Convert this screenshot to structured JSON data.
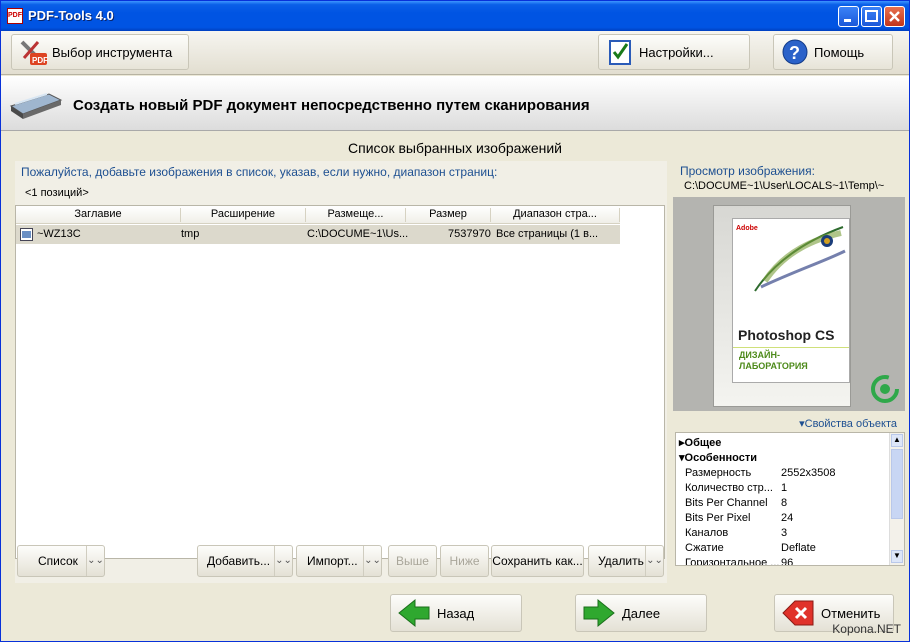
{
  "window": {
    "title": "PDF-Tools 4.0",
    "icon_text": "PDF"
  },
  "toolbar": {
    "select_tool": "Выбор инструмента",
    "settings": "Настройки...",
    "help": "Помощь"
  },
  "banner": {
    "title": "Создать новый PDF документ непосредственно путем сканирования"
  },
  "panel": {
    "header": "Список выбранных изображений",
    "hint": "Пожалуйста, добавьте изображения в список, указав, если нужно, диапазон страниц:",
    "count": "<1 позиций>"
  },
  "grid": {
    "columns": [
      "Заглавие",
      "Расширение",
      "Размеще...",
      "Размер",
      "Диапазон стра..."
    ],
    "rows": [
      {
        "name": "~WZ13C",
        "ext": "tmp",
        "location": "C:\\DOCUME~1\\Us...",
        "size": "7537970",
        "range": "Все страницы (1 в..."
      }
    ]
  },
  "list_buttons": {
    "list": "Список",
    "add": "Добавить...",
    "import": "Импорт...",
    "up": "Выше",
    "down": "Ниже",
    "save": "Сохранить как...",
    "delete": "Удалить"
  },
  "preview": {
    "label": "Просмотр изображения:",
    "path": "C:\\DOCUME~1\\User\\LOCALS~1\\Temp\\~",
    "book_brand": "Adobe",
    "book_title": "Photoshop CS",
    "book_sub1": "ДИЗАЙН-",
    "book_sub2": "ЛАБОРАТОРИЯ"
  },
  "properties": {
    "link": "Свойства объекта",
    "section_general": "Общее",
    "section_features": "Особенности",
    "items": [
      {
        "name": "Размерность",
        "value": "2552x3508"
      },
      {
        "name": "Количество стр...",
        "value": "1"
      },
      {
        "name": "Bits Per Channel",
        "value": "8"
      },
      {
        "name": "Bits Per Pixel",
        "value": "24"
      },
      {
        "name": "Каналов",
        "value": "3"
      },
      {
        "name": "Сжатие",
        "value": "Deflate"
      },
      {
        "name": "Горизонтальное ...",
        "value": "96"
      }
    ]
  },
  "footer": {
    "back": "Назад",
    "next": "Далее",
    "cancel": "Отменить"
  },
  "watermark": "Kopona.NET",
  "colors": {
    "titlebar": "#0054e3",
    "hint_text": "#1d4f91",
    "selected_row": "#dcd9cc",
    "next_arrow": "#2fa82f",
    "cancel_icon": "#e0322a"
  }
}
